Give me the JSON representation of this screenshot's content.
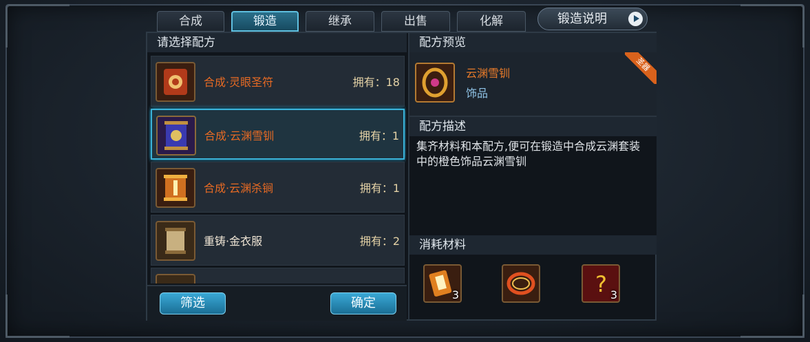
{
  "tabs": [
    {
      "label": "合成",
      "active": false
    },
    {
      "label": "锻造",
      "active": true
    },
    {
      "label": "继承",
      "active": false
    },
    {
      "label": "出售",
      "active": false
    },
    {
      "label": "化解",
      "active": false
    }
  ],
  "help_button": {
    "label": "锻造说明"
  },
  "left": {
    "header": "请选择配方",
    "recipes": [
      {
        "name": "合成·灵眼圣符",
        "own": "拥有：18",
        "icon": "scroll-icon"
      },
      {
        "name": "合成·云渊雪钏",
        "own": "拥有：1",
        "icon": "blue-scroll-icon",
        "selected": true
      },
      {
        "name": "合成·云渊杀锏",
        "own": "拥有：1",
        "icon": "scroll-icon"
      },
      {
        "name": "重铸·金衣服",
        "own": "拥有：2",
        "icon": "scroll-icon"
      }
    ],
    "filter_label": "筛选",
    "confirm_label": "确定"
  },
  "right": {
    "preview_header": "配方预览",
    "item_name": "云渊雪钏",
    "item_type": "饰品",
    "ribbon": "圣器",
    "desc_header": "配方描述",
    "description": "集齐材料和本配方,便可在锻造中合成云渊套装中的橙色饰品云渊雪钏",
    "materials_header": "消耗材料",
    "materials": [
      {
        "icon": "material-scroll-icon",
        "count": "3"
      },
      {
        "icon": "fire-ring-icon",
        "count": ""
      },
      {
        "icon": "unknown-item-icon",
        "count": "3"
      }
    ]
  },
  "colors": {
    "accent": "#3ab2d8",
    "orange_text": "#e66a24",
    "panel_bg": "#10151b"
  }
}
